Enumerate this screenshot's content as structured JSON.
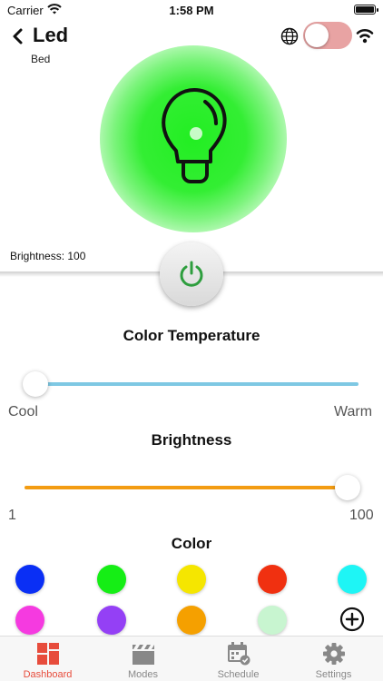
{
  "status_bar": {
    "carrier": "Carrier",
    "time": "1:58 PM"
  },
  "header": {
    "title": "Led",
    "subtitle": "Bed"
  },
  "device": {
    "power_on": false,
    "brightness_readout": "Brightness: 100",
    "bulb_color": "#33ee33"
  },
  "color_temperature": {
    "title": "Color Temperature",
    "min_label": "Cool",
    "max_label": "Warm",
    "value_fraction": 0.0,
    "track_color": "#7ec8e3"
  },
  "brightness": {
    "title": "Brightness",
    "min_label": "1",
    "max_label": "100",
    "value": 100,
    "track_color": "#f39c12"
  },
  "color": {
    "title": "Color",
    "swatches": [
      "#0a2ff5",
      "#15ee15",
      "#f5e600",
      "#f03010",
      "#1ef5f5",
      "#f53ae0",
      "#9440f5",
      "#f5a000",
      "#c8f5d0"
    ]
  },
  "tabs": [
    {
      "label": "Dashboard",
      "icon": "dashboard-icon",
      "active": true
    },
    {
      "label": "Modes",
      "icon": "clapperboard-icon",
      "active": false
    },
    {
      "label": "Schedule",
      "icon": "calendar-icon",
      "active": false
    },
    {
      "label": "Settings",
      "icon": "gear-icon",
      "active": false
    }
  ],
  "colors": {
    "accent": "#e74c3c",
    "power_icon": "#2e9e3e",
    "toggle_off": "#e8a3a3"
  }
}
